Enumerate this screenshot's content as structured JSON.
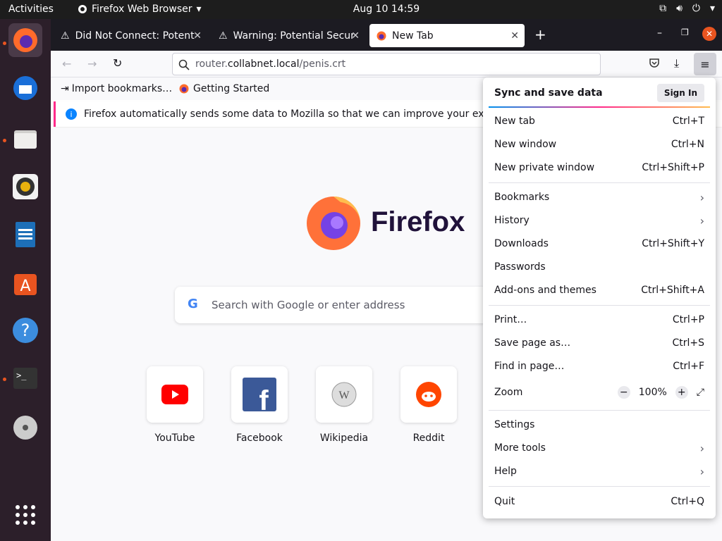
{
  "topbar": {
    "activities": "Activities",
    "app_name": "Firefox Web Browser",
    "clock": "Aug 10  14:59"
  },
  "tabs": [
    {
      "title": "Did Not Connect: Potenti",
      "icon": "warning-icon"
    },
    {
      "title": "Warning: Potential Securi",
      "icon": "warning-icon"
    },
    {
      "title": "New Tab",
      "icon": "firefox-icon"
    }
  ],
  "url": {
    "prefix": "router.",
    "domain": "collabnet.local",
    "path": "/penis.crt"
  },
  "bookmarks": [
    {
      "label": "Import bookmarks…"
    },
    {
      "label": "Getting Started"
    }
  ],
  "notice": {
    "text": "Firefox automatically sends some data to Mozilla so that we can improve your experie"
  },
  "brand": {
    "name": "Firefox"
  },
  "search": {
    "placeholder": "Search with Google or enter address"
  },
  "top_sites": [
    {
      "label": "YouTube"
    },
    {
      "label": "Facebook"
    },
    {
      "label": "Wikipedia"
    },
    {
      "label": "Reddit"
    }
  ],
  "menu": {
    "sync": {
      "label": "Sync and save data",
      "button": "Sign In"
    },
    "items": [
      {
        "label": "New tab",
        "shortcut": "Ctrl+T"
      },
      {
        "label": "New window",
        "shortcut": "Ctrl+N"
      },
      {
        "label": "New private window",
        "shortcut": "Ctrl+Shift+P"
      },
      {
        "label": "Bookmarks",
        "shortcut": "›"
      },
      {
        "label": "History",
        "shortcut": "›"
      },
      {
        "label": "Downloads",
        "shortcut": "Ctrl+Shift+Y"
      },
      {
        "label": "Passwords",
        "shortcut": ""
      },
      {
        "label": "Add-ons and themes",
        "shortcut": "Ctrl+Shift+A"
      },
      {
        "label": "Print…",
        "shortcut": "Ctrl+P"
      },
      {
        "label": "Save page as…",
        "shortcut": "Ctrl+S"
      },
      {
        "label": "Find in page…",
        "shortcut": "Ctrl+F"
      },
      {
        "label": "Settings",
        "shortcut": ""
      },
      {
        "label": "More tools",
        "shortcut": "›"
      },
      {
        "label": "Help",
        "shortcut": "›"
      },
      {
        "label": "Quit",
        "shortcut": "Ctrl+Q"
      }
    ],
    "zoom": {
      "label": "Zoom",
      "value": "100%",
      "minus": "−",
      "plus": "+"
    }
  },
  "colors": {
    "accent": "#e95420",
    "topbar": "#1d1d1d",
    "dock": "#2c1f2a",
    "tabstrip": "#1c1b22"
  }
}
